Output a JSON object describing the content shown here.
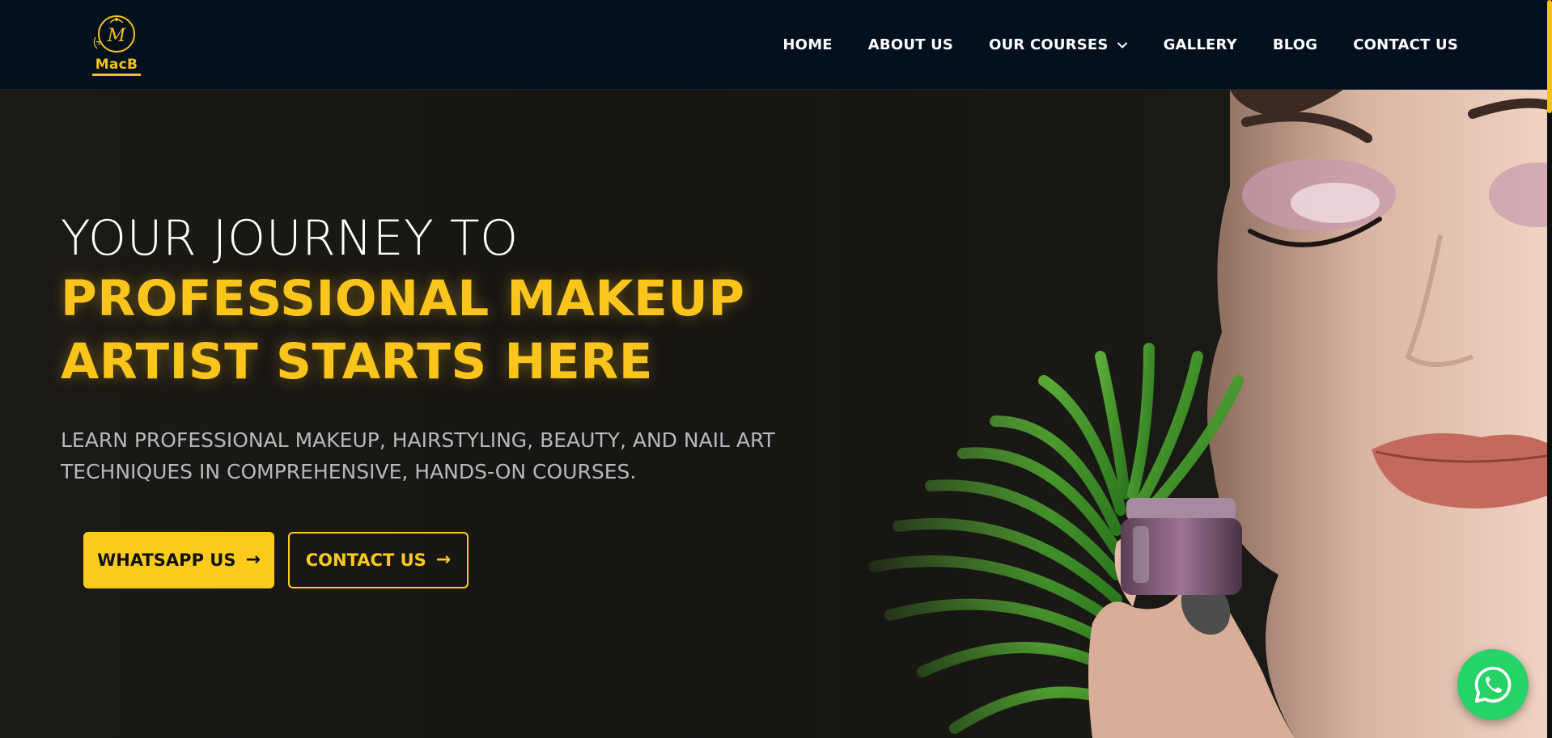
{
  "brand": {
    "logo_text": "MacB",
    "colors": {
      "accent": "#fccb1c",
      "header_bg": "#03101e",
      "hero_bg": "#181613",
      "whatsapp_green": "#25d366"
    }
  },
  "nav": {
    "items": [
      {
        "label": "HOME"
      },
      {
        "label": "ABOUT US"
      },
      {
        "label": "OUR COURSES",
        "icon": "chevron-down-icon"
      },
      {
        "label": "GALLERY"
      },
      {
        "label": "BLOG"
      },
      {
        "label": "CONTACT US"
      }
    ]
  },
  "hero": {
    "line1": "YOUR JOURNEY TO",
    "line2": "PROFESSIONAL MAKEUP",
    "line3": "ARTIST STARTS HERE",
    "subtitle": "LEARN PROFESSIONAL MAKEUP, HAIRSTYLING, BEAUTY, AND NAIL ART TECHNIQUES IN COMPREHENSIVE, HANDS-ON COURSES.",
    "buttons": {
      "whatsapp_label": "WHATSAPP US",
      "contact_label": "CONTACT US",
      "arrow": "→"
    }
  },
  "floating": {
    "whatsapp_icon": "whatsapp-icon"
  }
}
